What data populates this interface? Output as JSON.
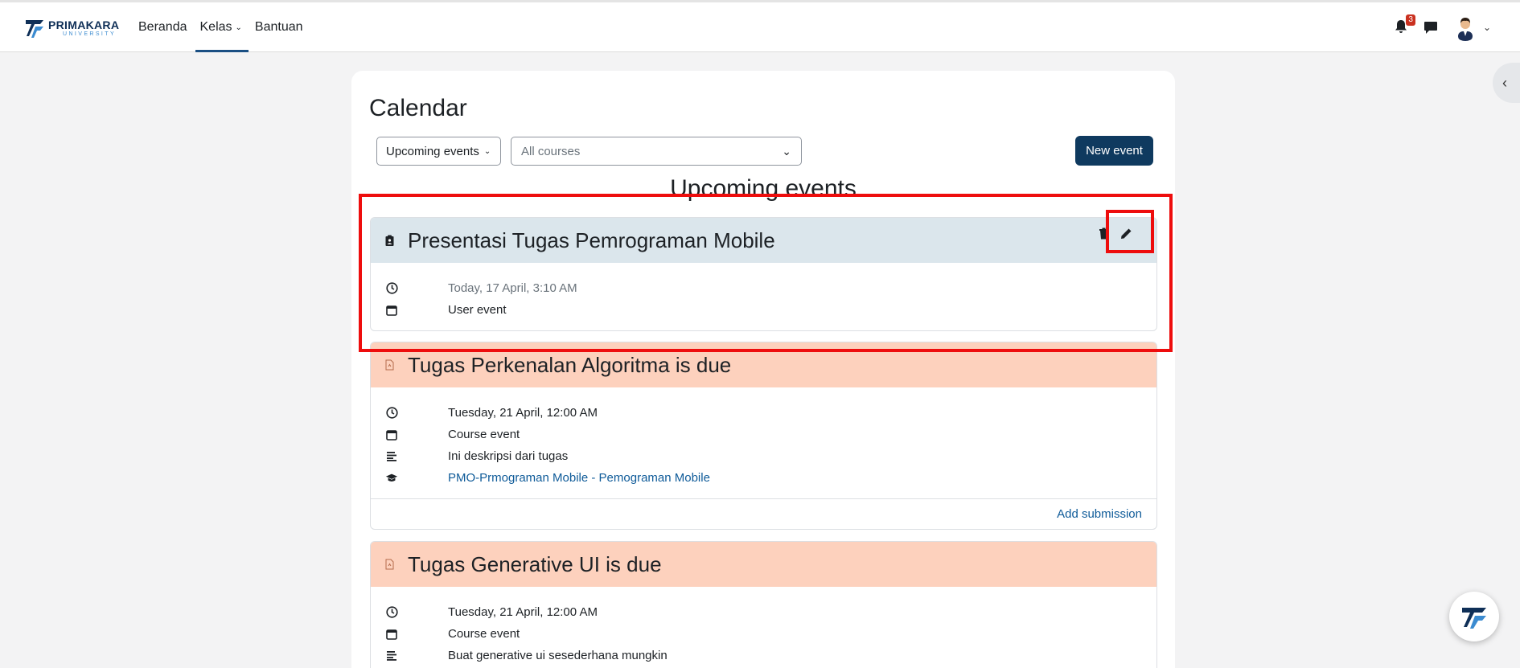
{
  "brand": {
    "name": "PRIMAKARA",
    "sub": "UNIVERSITY",
    "accent": "#0f2f57",
    "accent_light": "#3b8bd0"
  },
  "nav": {
    "items": [
      {
        "label": "Beranda"
      },
      {
        "label": "Kelas"
      },
      {
        "label": "Bantuan"
      }
    ],
    "active": "Kelas",
    "notification_count": "3"
  },
  "calendar": {
    "title": "Calendar",
    "view_select": "Upcoming events",
    "course_select": "All courses",
    "new_event_label": "New event",
    "section_title": "Upcoming events"
  },
  "events": [
    {
      "title": "Presentasi Tugas Pemrograman Mobile",
      "kind": "user",
      "time": "Today, 17 April, 3:10 AM",
      "type": "User event"
    },
    {
      "title": "Tugas Perkenalan Algoritma is due",
      "kind": "course",
      "time": "Tuesday, 21 April, 12:00 AM",
      "type": "Course event",
      "description": "Ini deskripsi dari tugas",
      "course": "PMO-Prmograman Mobile - Pemograman Mobile",
      "action": "Add submission"
    },
    {
      "title": "Tugas Generative UI is due",
      "kind": "course",
      "time": "Tuesday, 21 April, 12:00 AM",
      "type": "Course event",
      "description": "Buat generative ui sesederhana mungkin"
    }
  ],
  "colors": {
    "user_event_bg": "#dbe6ec",
    "course_event_bg": "#fdd1bd",
    "primary_button": "#0f3a5f",
    "highlight": "#ee0d0d"
  }
}
